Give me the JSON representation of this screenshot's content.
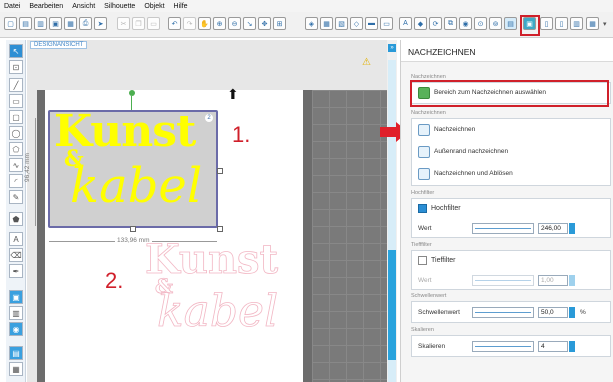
{
  "menu": [
    "Datei",
    "Bearbeiten",
    "Ansicht",
    "Silhouette",
    "Objekt",
    "Hilfe"
  ],
  "canvas": {
    "design_label": "DESIGNANSICHT",
    "step1": "1.",
    "step2": "2.",
    "width_label": "133,96 mm",
    "height_label": "96,42 mm",
    "logo_text_1": "Kunst",
    "logo_amp": "&",
    "logo_text_2": "kabel",
    "selection_badge": "2",
    "accent_yellow": "#ffff00",
    "accent_outline": "#f2b7c4",
    "step_color": "#d01f2a"
  },
  "panel": {
    "title": "NACHZEICHNEN",
    "section_area": "Nachzeichnen",
    "select_area_label": "Bereich zum Nachzeichnen auswählen",
    "section_trace": "Nachzeichnen",
    "trace_options": [
      "Nachzeichnen",
      "Außenrand nachzeichnen",
      "Nachzeichnen und Ablösen"
    ],
    "section_highpass": "Hochfilter",
    "highpass_label": "Hochfilter",
    "highpass_checked": true,
    "highpass_value_label": "Wert",
    "highpass_value": "246,00",
    "section_lowpass": "Tiefffilter",
    "lowpass_label": "Tieffilter",
    "lowpass_checked": false,
    "lowpass_value_label": "Wert",
    "lowpass_value": "1,00",
    "section_threshold": "Schwellenwert",
    "threshold_label": "Schwellenwert",
    "threshold_value": "50,0",
    "threshold_unit": "%",
    "section_scale": "Skalieren",
    "scale_label": "Skalieren",
    "scale_value": "4"
  }
}
